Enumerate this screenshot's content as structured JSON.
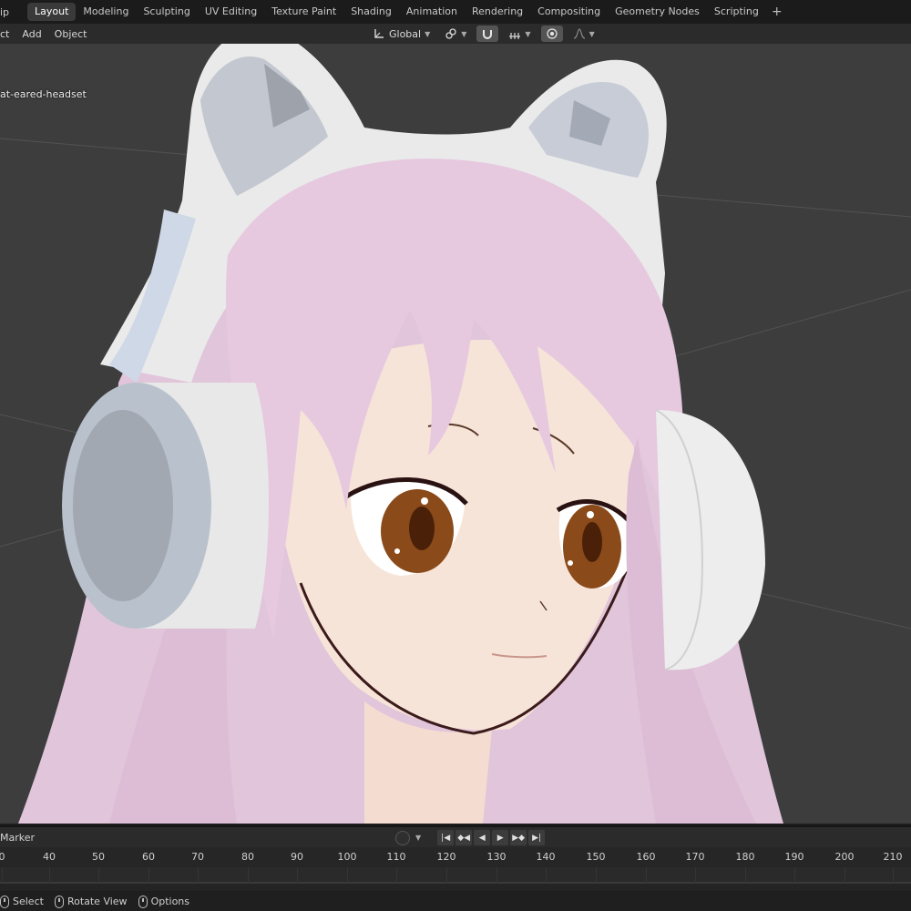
{
  "topbar": {
    "stub": "ip",
    "tabs": [
      "Layout",
      "Modeling",
      "Sculpting",
      "UV Editing",
      "Texture Paint",
      "Shading",
      "Animation",
      "Rendering",
      "Compositing",
      "Geometry Nodes",
      "Scripting"
    ],
    "active_tab": "Layout",
    "add_tab": "+"
  },
  "viewport_header": {
    "menus": [
      "ct",
      "Add",
      "Object"
    ],
    "transform_orientation": "Global"
  },
  "viewport": {
    "object_label": "at-eared-headset",
    "background_color": "#3d3d3d"
  },
  "timeline": {
    "marker_menu": "Marker",
    "ruler": [
      "0",
      "40",
      "50",
      "60",
      "70",
      "80",
      "90",
      "100",
      "110",
      "120",
      "130",
      "140",
      "150",
      "160",
      "170",
      "180",
      "190",
      "200",
      "210"
    ]
  },
  "statusbar": {
    "items": [
      "Select",
      "Rotate View",
      "Options"
    ]
  },
  "colors": {
    "accent_tab": "#3a3a3a",
    "hair": "#e3c8dc",
    "skin": "#f7e4d8",
    "eye": "#8a4a1a",
    "headset": "#eeeeee"
  }
}
